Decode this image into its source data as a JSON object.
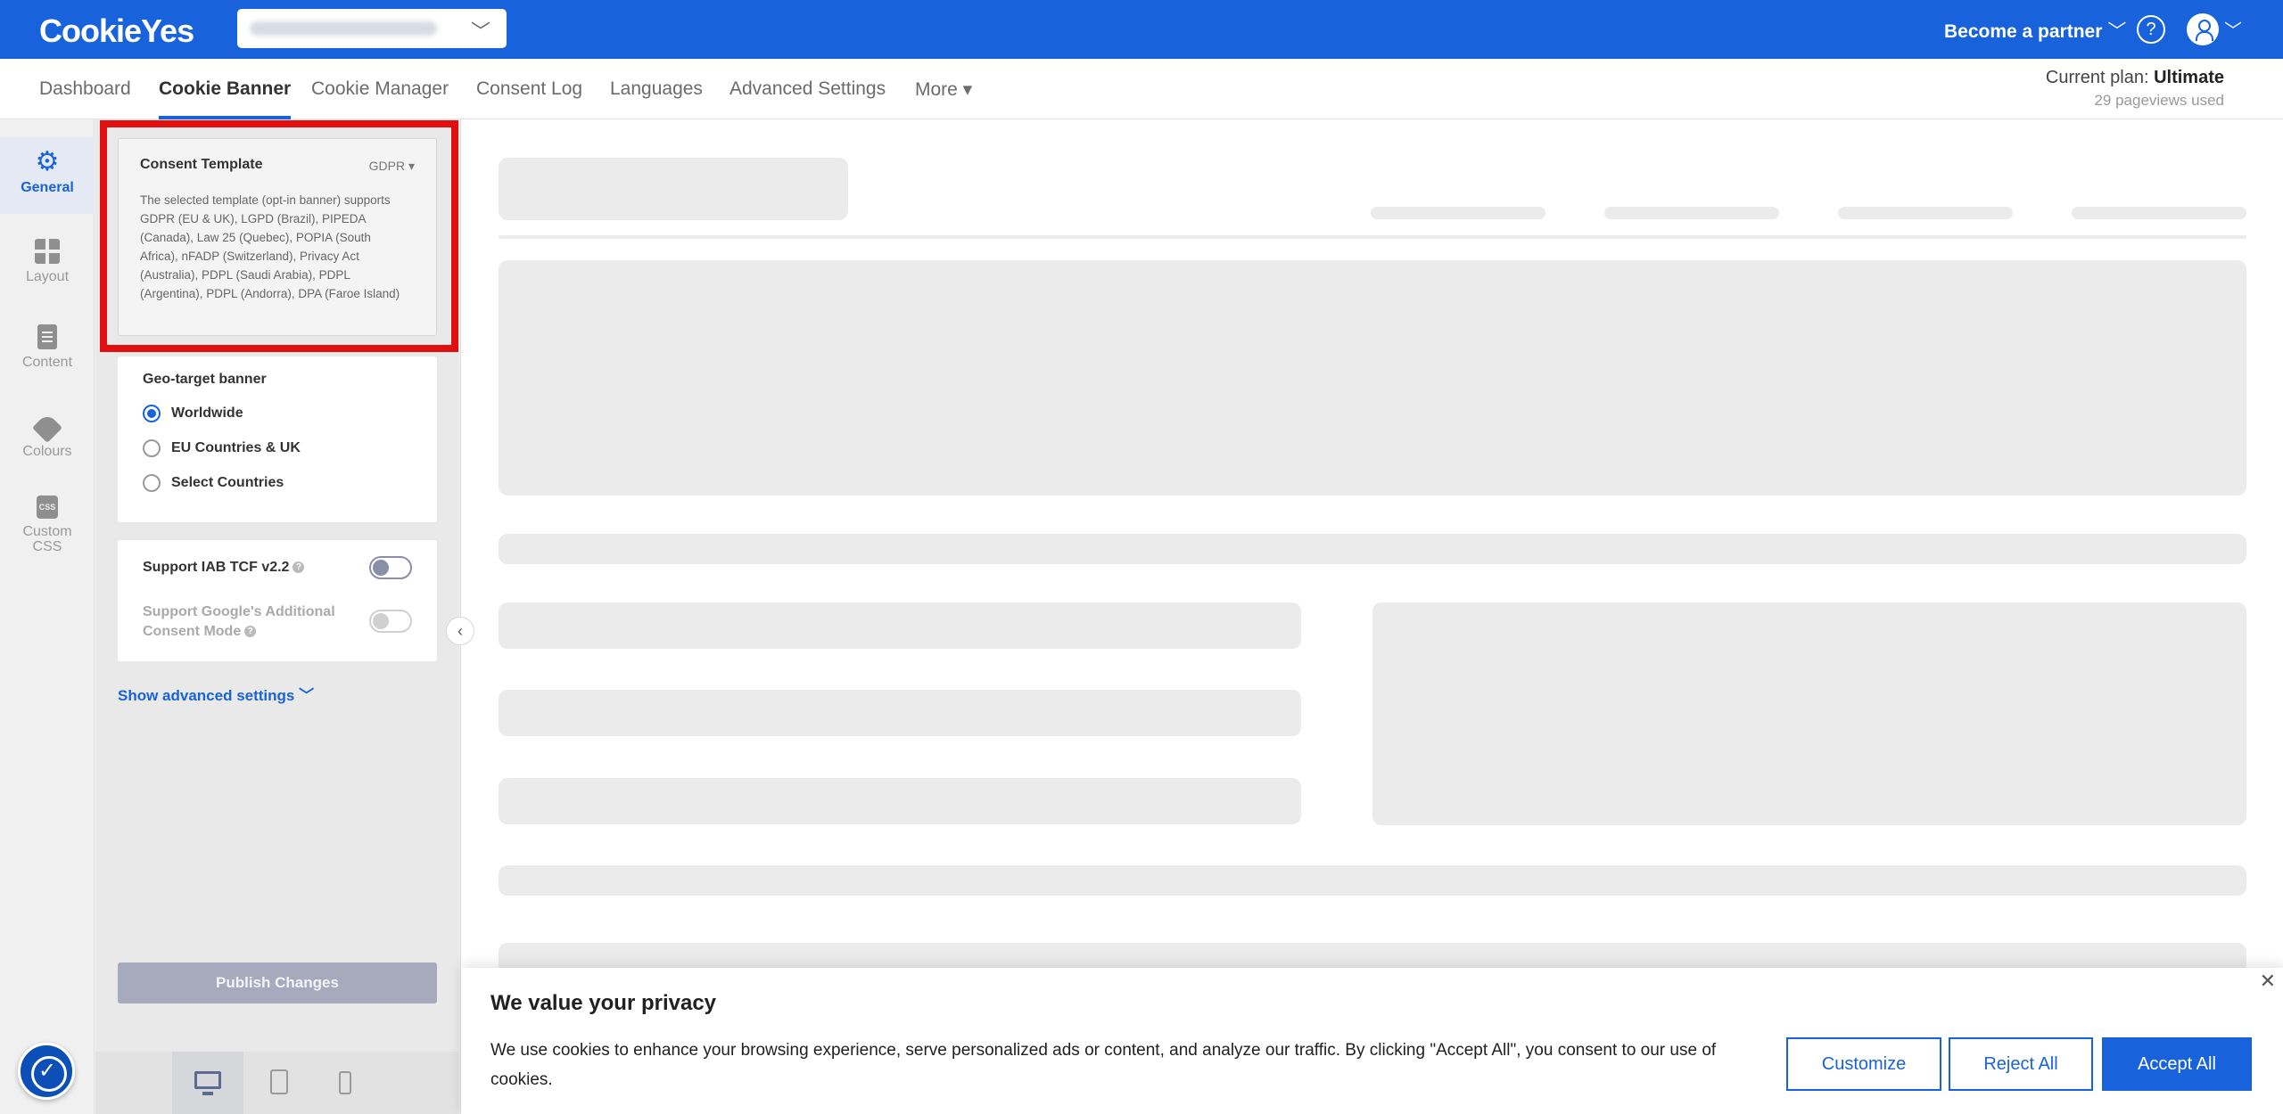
{
  "app": {
    "brand": "CookieYes"
  },
  "header": {
    "partner_label": "Become a partner",
    "partner_caret": "﹀",
    "help_glyph": "?",
    "select_chevron": "﹀",
    "user_caret": "﹀"
  },
  "nav": {
    "tabs": [
      {
        "label": "Dashboard"
      },
      {
        "label": "Cookie Banner"
      },
      {
        "label": "Cookie Manager"
      },
      {
        "label": "Consent Log"
      },
      {
        "label": "Languages"
      },
      {
        "label": "Advanced Settings"
      },
      {
        "label": "More ▾"
      }
    ],
    "plan_prefix": "Current plan: ",
    "plan_name": "Ultimate",
    "pageviews": "29 pageviews used"
  },
  "sidebar": {
    "items": [
      {
        "label": "General",
        "icon": "gear-icon",
        "glyph": "⚙"
      },
      {
        "label": "Layout",
        "icon": "layout-icon"
      },
      {
        "label": "Content",
        "icon": "content-icon"
      },
      {
        "label": "Colours",
        "icon": "colours-icon"
      },
      {
        "label": "Custom\nCSS",
        "label_line1": "Custom",
        "label_line2": "CSS",
        "icon": "css-icon",
        "glyph": "CSS"
      }
    ]
  },
  "panel": {
    "consent_template": {
      "title": "Consent Template",
      "selected": "GDPR ▾",
      "description": "The selected template (opt-in banner) supports GDPR (EU & UK), LGPD (Brazil), PIPEDA (Canada), Law 25 (Quebec), POPIA (South Africa), nFADP (Switzerland), Privacy Act (Australia), PDPL (Saudi Arabia), PDPL (Argentina), PDPL (Andorra), DPA (Faroe Island)"
    },
    "geo_target": {
      "title": "Geo-target banner",
      "options": [
        {
          "label": "Worldwide",
          "selected": true
        },
        {
          "label": "EU Countries & UK",
          "selected": false
        },
        {
          "label": "Select Countries",
          "selected": false
        }
      ]
    },
    "iab": {
      "tcf_label": "Support IAB TCF v2.2",
      "tcf_enabled": false,
      "google_label_line1": "Support Google's Additional",
      "google_label_line2": "Consent Mode",
      "google_enabled": false,
      "help_glyph": "?"
    },
    "advanced_link": "Show advanced settings ﹀",
    "publish_label": "Publish Changes",
    "collapse_glyph": "‹"
  },
  "cookie_banner": {
    "title": "We value your privacy",
    "text": "We use cookies to enhance your browsing experience, serve personalized ads or content, and analyze our traffic. By clicking \"Accept All\", you consent to our use of cookies.",
    "close_glyph": "✕",
    "customize_label": "Customize",
    "reject_label": "Reject All",
    "accept_label": "Accept All"
  },
  "colors": {
    "brand_blue": "#1863dc",
    "highlight_red": "#e10f0f",
    "skeleton_gray": "#ebebeb",
    "disabled_button": "#a7a9bd"
  }
}
